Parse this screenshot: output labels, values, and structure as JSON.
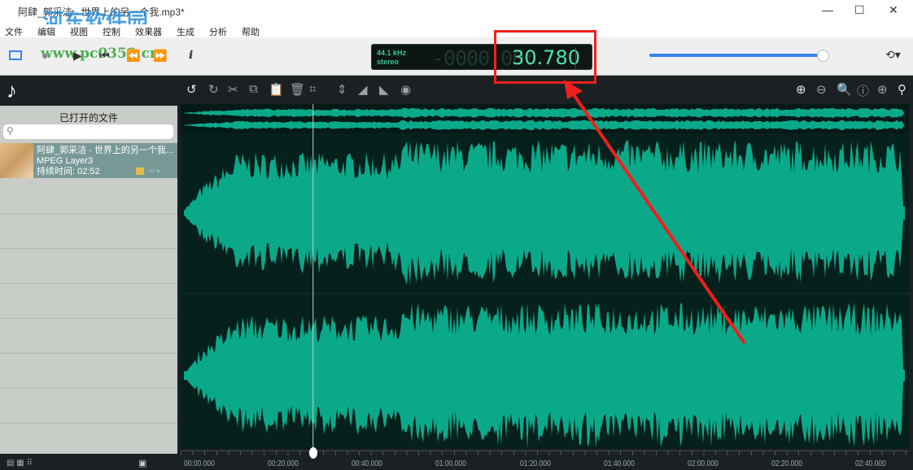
{
  "window": {
    "title": "阿肆_郭采洁 - 世界上的另一个我.mp3*",
    "minimize": "—",
    "maximize": "☐",
    "close": "✕"
  },
  "watermark": {
    "name": "河东软件园",
    "url": "www.pc0359.cn"
  },
  "menu": [
    "文件",
    "编辑",
    "视图",
    "控制",
    "效果器",
    "生成",
    "分析",
    "帮助"
  ],
  "transport": {
    "record": "●",
    "play": "▶",
    "to_start": "⏮",
    "rewind": "⏪",
    "forward": "⏩",
    "info": "i",
    "history": "⟲▾"
  },
  "display": {
    "sample_rate": "44.1 kHz",
    "channels": "stereo",
    "time_dim": "-0000:00:",
    "time": "30.780"
  },
  "volume": {
    "value": 100
  },
  "panel": {
    "title": "已打开的文件",
    "search_placeholder": "",
    "files": [
      {
        "name": "阿肆_郭采洁 - 世界上的另一个我...",
        "format": "MPEG Layer3",
        "duration": "持续时间: 02:52"
      }
    ]
  },
  "edit_tools": [
    "↺",
    "↻",
    "✂",
    "⧉",
    "📋",
    "🗑",
    "⌗",
    "⇕",
    "◢",
    "◣",
    "◉"
  ],
  "zoom_tools": [
    "⊕",
    "⊖",
    "🔍",
    "ⓘ",
    "⊕",
    "⚲"
  ],
  "timeline": [
    "00:00.000",
    "00:20.000",
    "00:40.000",
    "01:00.000",
    "01:20.000",
    "01:40.000",
    "02:00.000",
    "02:20.000",
    "02:40.000"
  ],
  "playhead_seconds": 30.78,
  "total_seconds": 172,
  "colors": {
    "wave": "#0aa98a",
    "annotation": "#f0201c",
    "accent": "#3b82f0"
  }
}
